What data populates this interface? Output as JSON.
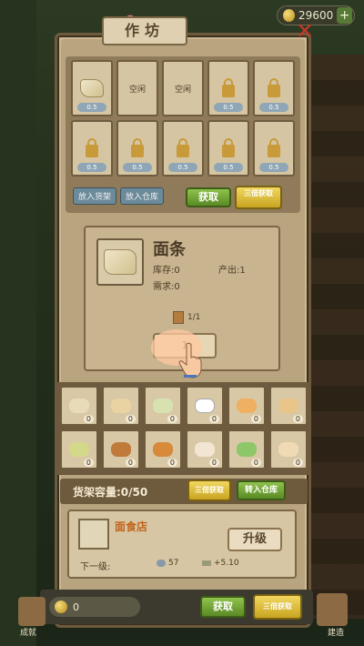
{
  "currency": {
    "amount": "29600"
  },
  "window": {
    "title": "作坊"
  },
  "slots": [
    {
      "type": "item",
      "badge": "0.5"
    },
    {
      "type": "empty",
      "label": "空闲"
    },
    {
      "type": "empty",
      "label": "空闲"
    },
    {
      "type": "locked",
      "badge": "0.5"
    },
    {
      "type": "locked",
      "badge": "0.5"
    },
    {
      "type": "locked",
      "badge": "0.5"
    },
    {
      "type": "locked",
      "badge": "0.5"
    },
    {
      "type": "locked",
      "badge": "0.5"
    },
    {
      "type": "locked",
      "badge": "0.5"
    },
    {
      "type": "locked",
      "badge": "0.5"
    }
  ],
  "slot_actions": {
    "put_shelf": "放入货架",
    "put_warehouse": "放入仓库"
  },
  "buttons": {
    "collect": "获取",
    "triple": "三倍获取",
    "move_to_warehouse": "转入仓库",
    "upgrade": "升级"
  },
  "product": {
    "name": "面条",
    "stock_label": "库存:0",
    "output_label": "产出:1",
    "demand_label": "需求:0",
    "progress": "1/1",
    "make_label": "1"
  },
  "inventory": [
    {
      "name": "noodles",
      "count": "0",
      "color": "#e8dcb8"
    },
    {
      "name": "bun",
      "count": "0",
      "color": "#e9d3a3"
    },
    {
      "name": "dumpling",
      "count": "0",
      "color": "#d7e2b0"
    },
    {
      "name": "plate",
      "count": "0",
      "color": "#ffffff"
    },
    {
      "name": "cake",
      "count": "0",
      "color": "#f0b061"
    },
    {
      "name": "wrap",
      "count": "0",
      "color": "#e9c58a"
    },
    {
      "name": "salad",
      "count": "0",
      "color": "#d4d98a"
    },
    {
      "name": "twist",
      "count": "0",
      "color": "#c07a3a"
    },
    {
      "name": "stick",
      "count": "0",
      "color": "#d68a3a"
    },
    {
      "name": "rice-ball",
      "count": "0",
      "color": "#f2e6d2"
    },
    {
      "name": "veg-plate",
      "count": "0",
      "color": "#8ec66a"
    },
    {
      "name": "dumpling-plate",
      "count": "0",
      "color": "#f0d9b5"
    }
  ],
  "shelf": {
    "label": "货架容量:0/50"
  },
  "shop": {
    "name": "面食店",
    "next_label": "下一级:",
    "stat1": "57",
    "stat2": "+5.10"
  },
  "bottom": {
    "coins": "0",
    "collect": "获取",
    "triple": "三倍获取"
  },
  "side_labels": {
    "left": "成就",
    "right": "建造"
  }
}
